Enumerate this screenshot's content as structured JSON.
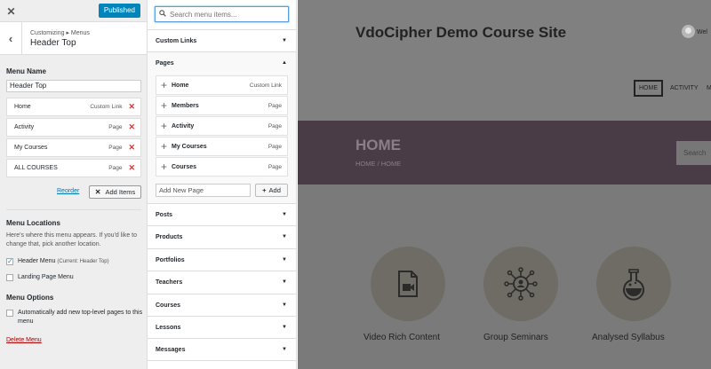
{
  "customizer": {
    "publish_label": "Published",
    "breadcrumb": "Customizing ▸ Menus",
    "section_title": "Header Top",
    "menu_name_label": "Menu Name",
    "menu_name_value": "Header Top",
    "menu_items": [
      {
        "title": "Home",
        "type": "Custom Link"
      },
      {
        "title": "Activity",
        "type": "Page"
      },
      {
        "title": "My Courses",
        "type": "Page"
      },
      {
        "title": "ALL COURSES",
        "type": "Page"
      }
    ],
    "reorder_label": "Reorder",
    "add_items_label": "Add Items",
    "menu_locations_label": "Menu Locations",
    "menu_locations_desc": "Here's where this menu appears. If you'd like to change that, pick another location.",
    "location_header_label": "Header Menu",
    "location_header_current": "(Current: Header Top)",
    "location_header_checked": true,
    "location_landing_label": "Landing Page Menu",
    "location_landing_checked": false,
    "menu_options_label": "Menu Options",
    "auto_add_label": "Automatically add new top-level pages to this menu",
    "auto_add_checked": false,
    "delete_menu_label": "Delete Menu"
  },
  "available": {
    "search_placeholder": "Search menu items...",
    "custom_links_label": "Custom Links",
    "pages_label": "Pages",
    "pages": [
      {
        "title": "Home",
        "type": "Custom Link"
      },
      {
        "title": "Members",
        "type": "Page"
      },
      {
        "title": "Activity",
        "type": "Page"
      },
      {
        "title": "My Courses",
        "type": "Page"
      },
      {
        "title": "Courses",
        "type": "Page"
      }
    ],
    "new_page_placeholder": "Add New Page",
    "add_label": "Add",
    "sections": [
      "Posts",
      "Products",
      "Portfolios",
      "Teachers",
      "Courses",
      "Lessons",
      "Messages"
    ]
  },
  "preview": {
    "site_title": "VdoCipher Demo Course Site",
    "welcome_text": "Wel",
    "nav": {
      "home": "HOME",
      "activity": "ACTIVITY",
      "more": "M"
    },
    "banner_title": "HOME",
    "banner_crumb": "HOME  /  HOME",
    "search_text": "Search",
    "features": [
      {
        "label": "Video Rich Content",
        "icon": "video-file-icon"
      },
      {
        "label": "Group Seminars",
        "icon": "network-people-icon"
      },
      {
        "label": "Analysed Syllabus",
        "icon": "flask-icon"
      }
    ]
  },
  "colors": {
    "accent": "#0085ba",
    "delete": "#dc3232",
    "banner": "#4a3c46"
  }
}
